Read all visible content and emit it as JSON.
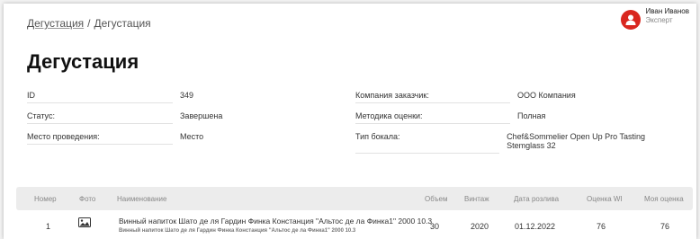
{
  "breadcrumb": {
    "link": "Дегустация",
    "separator": "/",
    "current": "Дегустация"
  },
  "user": {
    "name": "Иван Иванов",
    "role": "Эксперт",
    "avatar_color": "#d9271f"
  },
  "page_title": "Дегустация",
  "info": {
    "left": [
      {
        "label": "ID",
        "value": "349"
      },
      {
        "label": "Статус:",
        "value": "Завершена"
      },
      {
        "label": "Место проведения:",
        "value": "Место"
      }
    ],
    "right": [
      {
        "label": "Компания заказчик:",
        "value": "ООО Компания"
      },
      {
        "label": "Методика оценки:",
        "value": "Полная"
      },
      {
        "label": "Тип бокала:",
        "value": "Chef&Sommelier Open Up Pro Tasting Stemglass 32"
      }
    ]
  },
  "table": {
    "headers": {
      "number": "Номер",
      "photo": "Фото",
      "name": "Наименование",
      "volume": "Объем",
      "vintage": "Винтаж",
      "bottling_date": "Дата розлива",
      "wi_score": "Оценка WI",
      "my_score": "Моя оценка"
    },
    "rows": [
      {
        "number": "1",
        "photo_icon": "image-icon",
        "name": "Винный напиток Шато де ля Гардин Финка Констанция \"Альтос де ла Финка1\" 2000 10.3",
        "name_sub": "Винный напиток Шато де ля Гардин Финка Констанция \"Альтос де ла Финка1\" 2000 10.3",
        "volume": "30",
        "vintage": "2020",
        "bottling_date": "01.12.2022",
        "wi_score": "76",
        "my_score": "76"
      }
    ]
  }
}
